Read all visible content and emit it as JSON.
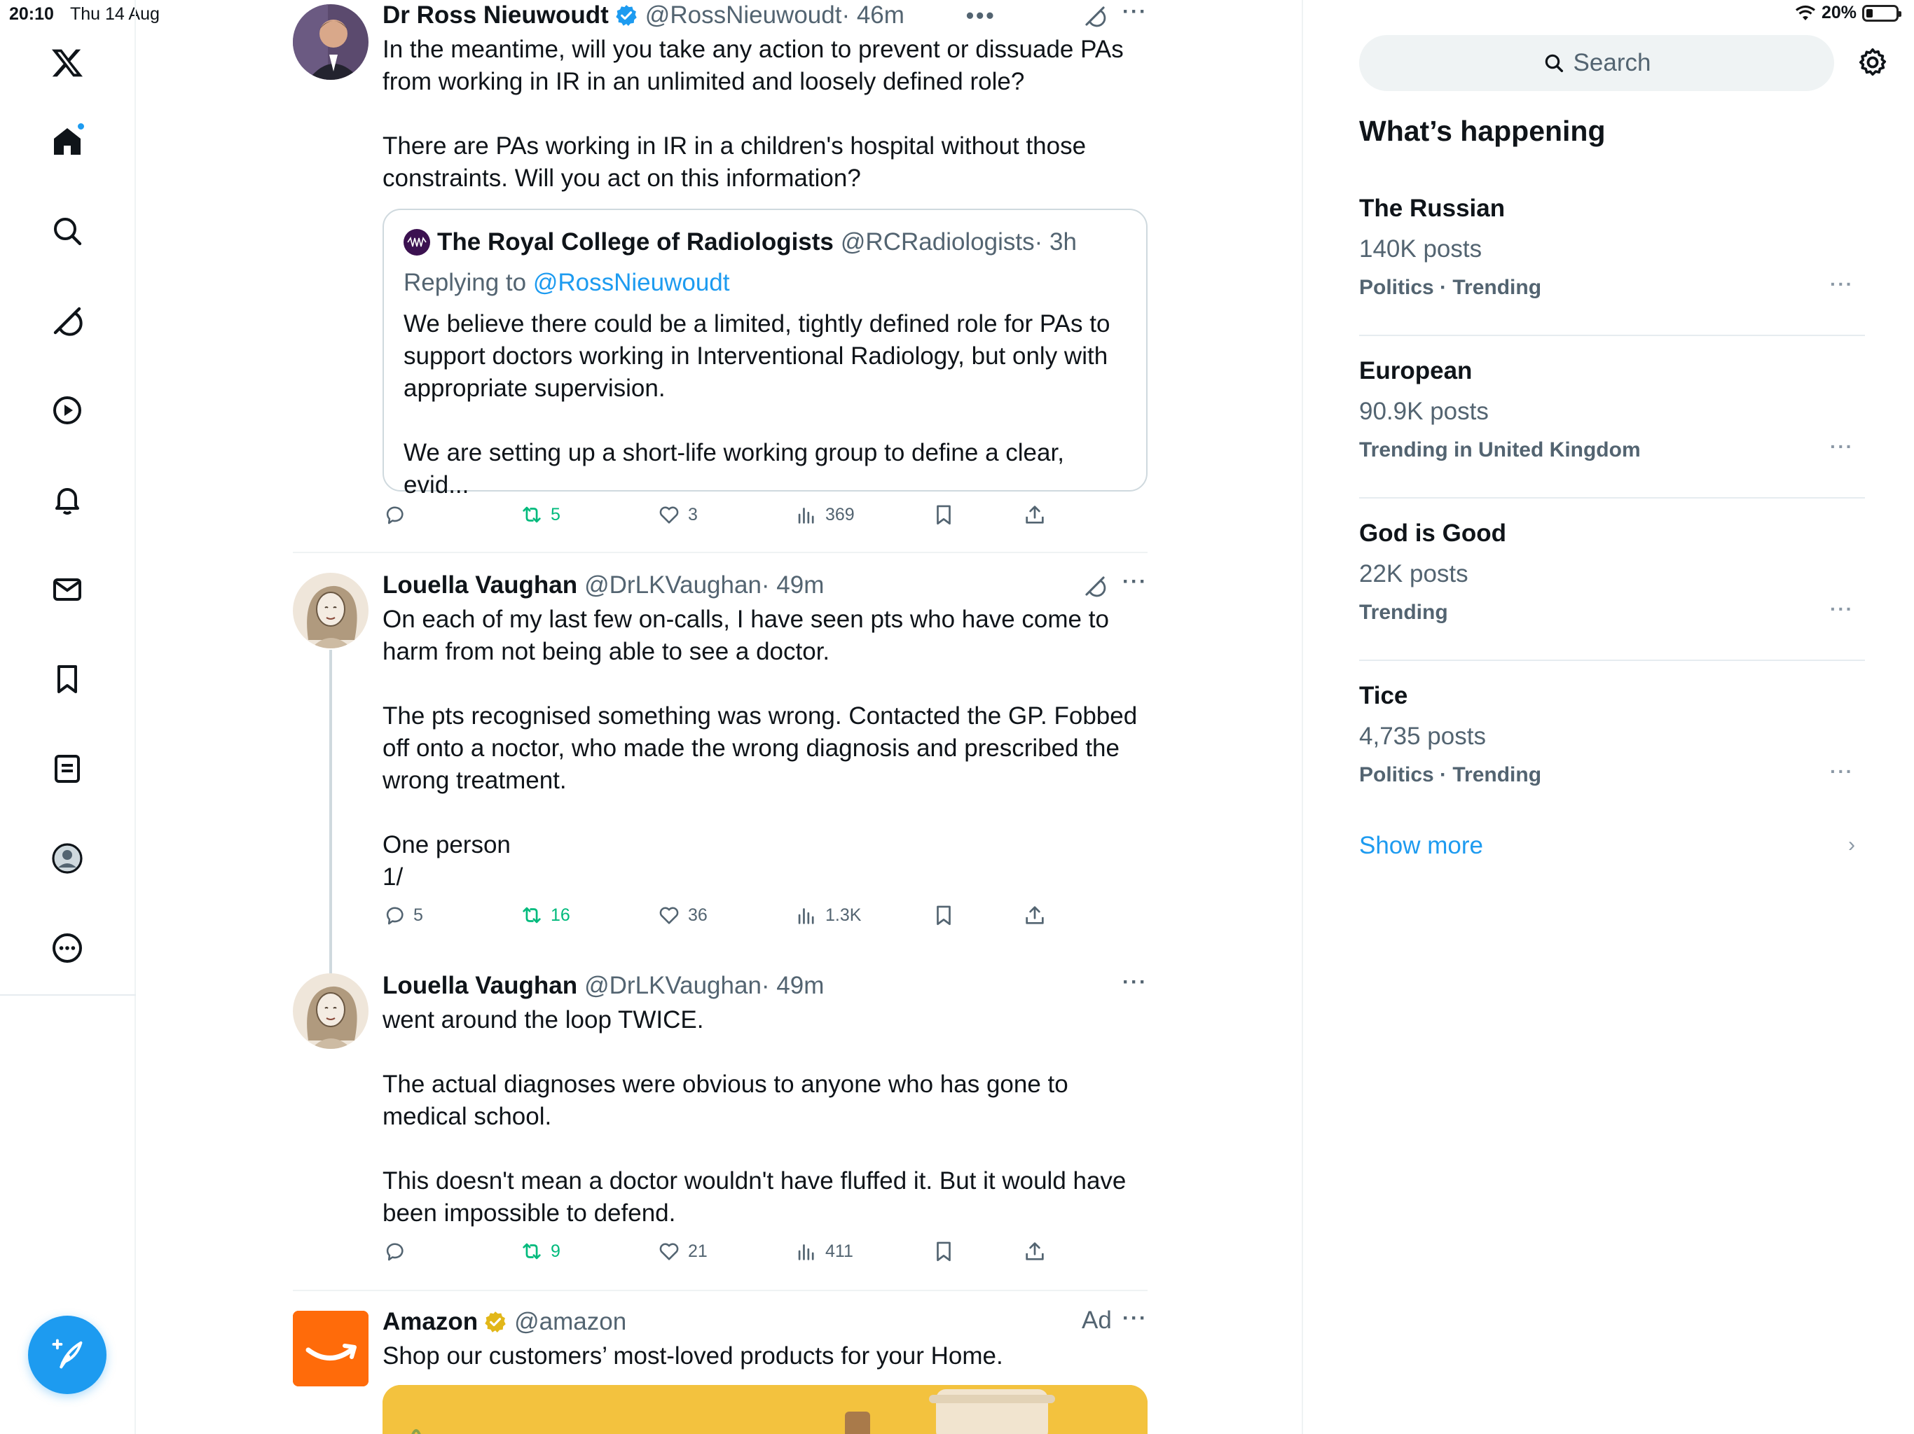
{
  "status": {
    "time": "20:10",
    "date": "Thu 14 Aug",
    "battery": "20%",
    "battery_level": 0.2
  },
  "nav": {
    "items": [
      {
        "name": "x-logo-icon"
      },
      {
        "name": "home-icon"
      },
      {
        "name": "explore-icon"
      },
      {
        "name": "grok-icon"
      },
      {
        "name": "video-icon"
      },
      {
        "name": "notifications-icon"
      },
      {
        "name": "messages-icon"
      },
      {
        "name": "bookmarks-icon"
      },
      {
        "name": "lists-icon"
      },
      {
        "name": "profile-icon"
      },
      {
        "name": "more-icon"
      }
    ],
    "compose": "compose-icon"
  },
  "tweets": [
    {
      "name": "Dr Ross Nieuwoudt",
      "handle": "@RossNieuwoudt",
      "time": "· 46m",
      "verified": true,
      "body": "In the meantime, will you take any action to prevent or dissuade PAs from working in IR in an unlimited and loosely defined role?\n\nThere are PAs working in IR in a children's hospital without those constraints. Will you act on this information?",
      "quote": {
        "name": "The Royal College of Radiologists",
        "handle": "@RCRadiologists",
        "time": "· 3h",
        "replying": "Replying to",
        "replying_to": "@RossNieuwoudt",
        "body": "We believe there could be a limited, tightly defined role for PAs to support doctors working in Interventional Radiology, but only with appropriate supervision.\n\nWe are setting up a short-life working group to define a clear, evid..."
      },
      "replies": "",
      "retweets": "5",
      "likes": "3",
      "views": "369"
    },
    {
      "name": "Louella Vaughan",
      "handle": "@DrLKVaughan",
      "time": "· 49m",
      "body": "On each of my last few on-calls, I have seen pts who have come to harm from not being able to see a doctor.\n\nThe pts recognised something was wrong. Contacted the GP. Fobbed off onto a noctor, who made the wrong diagnosis and prescribed the wrong treatment.\n\nOne person\n1/",
      "replies": "5",
      "retweets": "16",
      "likes": "36",
      "views": "1.3K"
    },
    {
      "name": "Louella Vaughan",
      "handle": "@DrLKVaughan",
      "time": "· 49m",
      "body": "went around the loop TWICE.\n\nThe actual diagnoses were obvious to anyone who has gone to medical school.\n\nThis doesn't mean a doctor wouldn't have fluffed it. But it would have been impossible to defend.",
      "replies": "",
      "retweets": "9",
      "likes": "21",
      "views": "411"
    }
  ],
  "ad": {
    "name": "Amazon",
    "handle": "@amazon",
    "label": "Ad",
    "body": "Shop our customers’ most-loved products for your Home."
  },
  "sidebar": {
    "search_placeholder": "Search",
    "heading": "What’s happening",
    "trends": [
      {
        "name": "The Russian",
        "count": "140K posts",
        "category": "Politics · Trending"
      },
      {
        "name": "European",
        "count": "90.9K posts",
        "category": "Trending in United Kingdom"
      },
      {
        "name": "God is Good",
        "count": "22K posts",
        "category": "Trending"
      },
      {
        "name": "Tice",
        "count": "4,735 posts",
        "category": "Politics · Trending"
      }
    ],
    "show_more": "Show more"
  },
  "colors": {
    "accent": "#1d9bf0",
    "retweet": "#00ba7c",
    "secondary_text": "#536471",
    "amazon": "#ff6b0a"
  }
}
